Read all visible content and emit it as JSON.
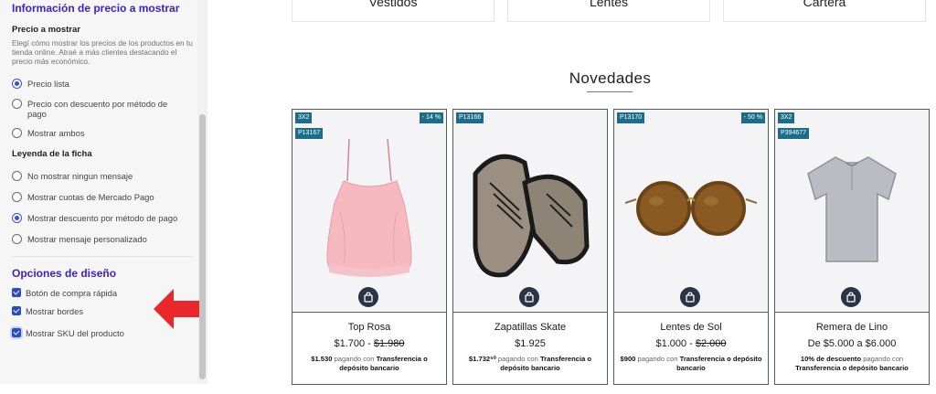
{
  "panel": {
    "price_section_title": "Información de precio a mostrar",
    "price_to_show_title": "Precio a mostrar",
    "price_to_show_desc": "Elegí cómo mostrar los precios de los productos en tu tienda online. Atraé a más clientes destacando el precio más económico.",
    "price_options": [
      {
        "label": "Precio lista",
        "selected": true
      },
      {
        "label": "Precio con descuento por método de pago",
        "selected": false
      },
      {
        "label": "Mostrar ambos",
        "selected": false
      }
    ],
    "legend_title": "Leyenda de la ficha",
    "legend_options": [
      {
        "label": "No mostrar ningun mensaje",
        "selected": false
      },
      {
        "label": "Mostrar cuotas de Mercado Pago",
        "selected": false
      },
      {
        "label": "Mostrar descuento por método de pago",
        "selected": true
      },
      {
        "label": "Mostrar mensaje personalizado",
        "selected": false
      }
    ],
    "design_section_title": "Opciones de diseño",
    "design_options": [
      {
        "label": "Botón de compra rápida",
        "checked": true
      },
      {
        "label": "Mostrar bordes",
        "checked": true
      },
      {
        "label": "Mostrar SKU del producto",
        "checked": true
      }
    ]
  },
  "categories": [
    "Vestidos",
    "Lentes",
    "Cartera"
  ],
  "section_title": "Novedades",
  "products": [
    {
      "name": "Top Rosa",
      "price": "$1.700",
      "old_price": "$1.980",
      "promo_price": "$1.530",
      "promo_mid": "pagando con",
      "promo_method": "Transferencia o depósito bancario",
      "badge_promo": "3X2",
      "badge_discount": "- 14 %",
      "sku": "P13167"
    },
    {
      "name": "Zapatillas Skate",
      "price": "$1.925",
      "promo_price": "$1.732⁵⁰",
      "promo_mid": "pagando con",
      "promo_method": "Transferencia o depósito bancario",
      "sku": "P13166"
    },
    {
      "name": "Lentes de Sol",
      "price": "$1.000",
      "old_price": "$2.000",
      "promo_price": "$900",
      "promo_mid": "pagando con",
      "promo_method": "Transferencia o depósito bancario",
      "badge_discount": "- 50 %",
      "sku": "P13170"
    },
    {
      "name": "Remera de Lino",
      "price_range": "De $5.000 a $6.000",
      "promo_price": "10% de descuento",
      "promo_mid": "pagando con",
      "promo_method": "Transferencia o depósito bancario",
      "badge_promo": "3X2",
      "sku": "P394677"
    }
  ],
  "colors": {
    "accent": "#3a22c4",
    "radio_selected": "#3a4fd6",
    "checkbox": "#2b4cc4",
    "tag": "#1b6d8a",
    "cart_button": "#2a3447",
    "arrow": "#e8282b"
  },
  "icons": {
    "cart": "shopping-bag-icon",
    "arrow": "arrow-left-icon"
  }
}
